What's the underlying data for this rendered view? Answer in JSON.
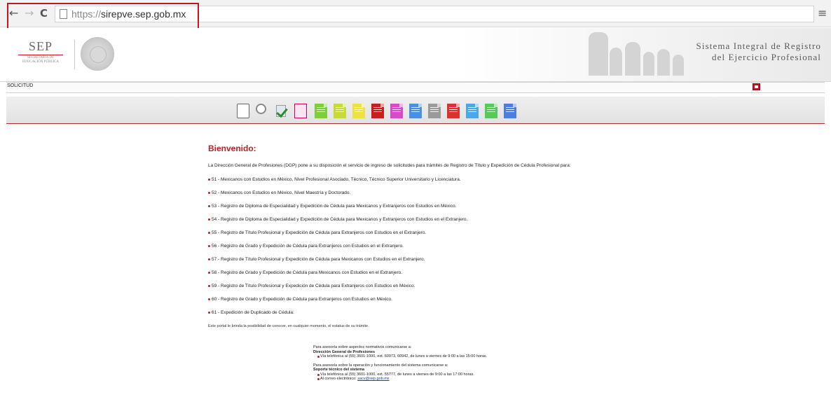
{
  "browser": {
    "url_protocol": "https://",
    "url_host": "sirepve.sep.gob.mx",
    "back_icon": "←",
    "forward_icon": "→",
    "reload_icon": "C",
    "menu_icon": "≡"
  },
  "header": {
    "logo_big": "SEP",
    "logo_small_1": "SECRETARÍA DE",
    "logo_small_2": "EDUCACIÓN PÚBLICA",
    "system_title_1": "Sistema Integral de Registro",
    "system_title_2": "del Ejercicio Profesional"
  },
  "solbar": {
    "label": "SOLICITUD"
  },
  "toolbar": {
    "icons": [
      "sign-document-icon",
      "search-icon",
      "check-document-icon",
      "pdf-icon",
      "green-document-icon",
      "yellow-green-document-icon",
      "yellow-document-icon",
      "red-document-icon",
      "magenta-document-icon",
      "blue-document-icon",
      "gray-document-icon",
      "red-document-icon",
      "blue-document-icon",
      "green-document-icon",
      "blue-document-icon"
    ],
    "colors": [
      "#ffffff",
      "#ffffff",
      "#dfe8ee",
      "#fbe6f0",
      "#7ccf3a",
      "#c8d93a",
      "#f0e040",
      "#c81e1e",
      "#d84ac8",
      "#4a8fe0",
      "#9a9a9a",
      "#d83232",
      "#4aa8e8",
      "#58c858",
      "#4a7ee0"
    ]
  },
  "content": {
    "title": "Bienvenido:",
    "intro": "La Dirección General de Profesiones (DGP) pone a su disposición el servicio de ingreso de solicitudes para trámites de Registro de Título y Expedición de Cédula Profesional para:",
    "items": [
      "51 - Mexicanos con Estudios en México, Nivel Profesional Asociado, Técnico, Técnico Superior Universitario y Licenciatura.",
      "52 - Mexicanos con Estudios en México, Nivel Maestría y Doctorado.",
      "53 - Registro de Diploma de Especialidad y Expedición de Cédula para Mexicanos y Extranjeros con Estudios en México.",
      "54 - Registro de Diploma de Especialidad y Expedición de Cédula para Mexicanos y Extranjeros con Estudios en el Extranjero.",
      "55 - Registro de Título Profesional y Expedición de Cédula para Extranjeros con Estudios en el Extranjero.",
      "56 - Registro de Grado y Expedición de Cédula para Extranjeros con Estudios en el Extranjero.",
      "57 - Registro de Título Profesional y Expedición de Cédula para Mexicanos con Estudios en el Extranjero.",
      "58 - Registro de Grado y Expedición de Cédula para Mexicanos con Estudios en el Extranjero.",
      "59 - Registro de Título Profesional y Expedición de Cédula para Extranjeros con Estudios en México.",
      "60 - Registro de Grado y Expedición de Cédula para Extranjeros con Estudios en México.",
      "61 - Expedición de Duplicado de Cédula."
    ],
    "portal_note": "Este portal le brinda la posibilidad de conocer, en cualquier momento, el estatus de su trámite."
  },
  "contact": {
    "normative_intro": "Para asesoría sobre aspectos normativos comunicarse a:",
    "normative_org": "Dirección General de Profesiones",
    "normative_phone": "Vía telefónica al (55) 3601-1000, ext. 60973, 60942, de lunes a viernes de 9:00 a las 15:00 horas.",
    "support_intro": "Para asesoría sobre la operación y funcionamiento del sistema comunicarse a:",
    "support_org": "Soporte técnico del sistema",
    "support_phone": "Vía telefónica al (55) 3601-1000, ext. 55777, de lunes a viernes de 9:00 a las 17:00 horas.",
    "support_email_label": "Al correo electrónico:",
    "support_email": "sacv@sep.gob.mx"
  }
}
